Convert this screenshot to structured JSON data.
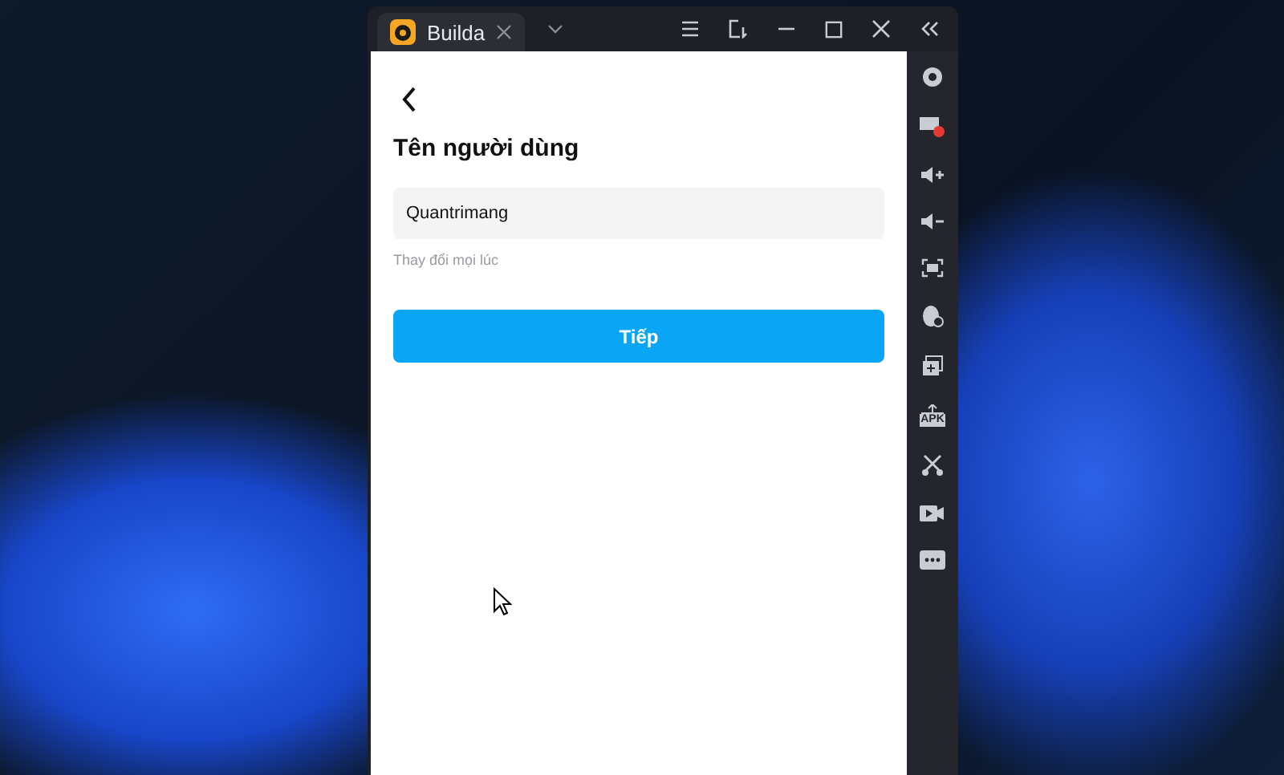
{
  "window": {
    "tab_title": "Builda"
  },
  "screen": {
    "title": "Tên người dùng",
    "username_field": {
      "value": "Quantrimang"
    },
    "hint": "Thay đổi mọi lúc",
    "next_button": "Tiếp"
  },
  "sidebar": {
    "apk_label": "APK"
  }
}
